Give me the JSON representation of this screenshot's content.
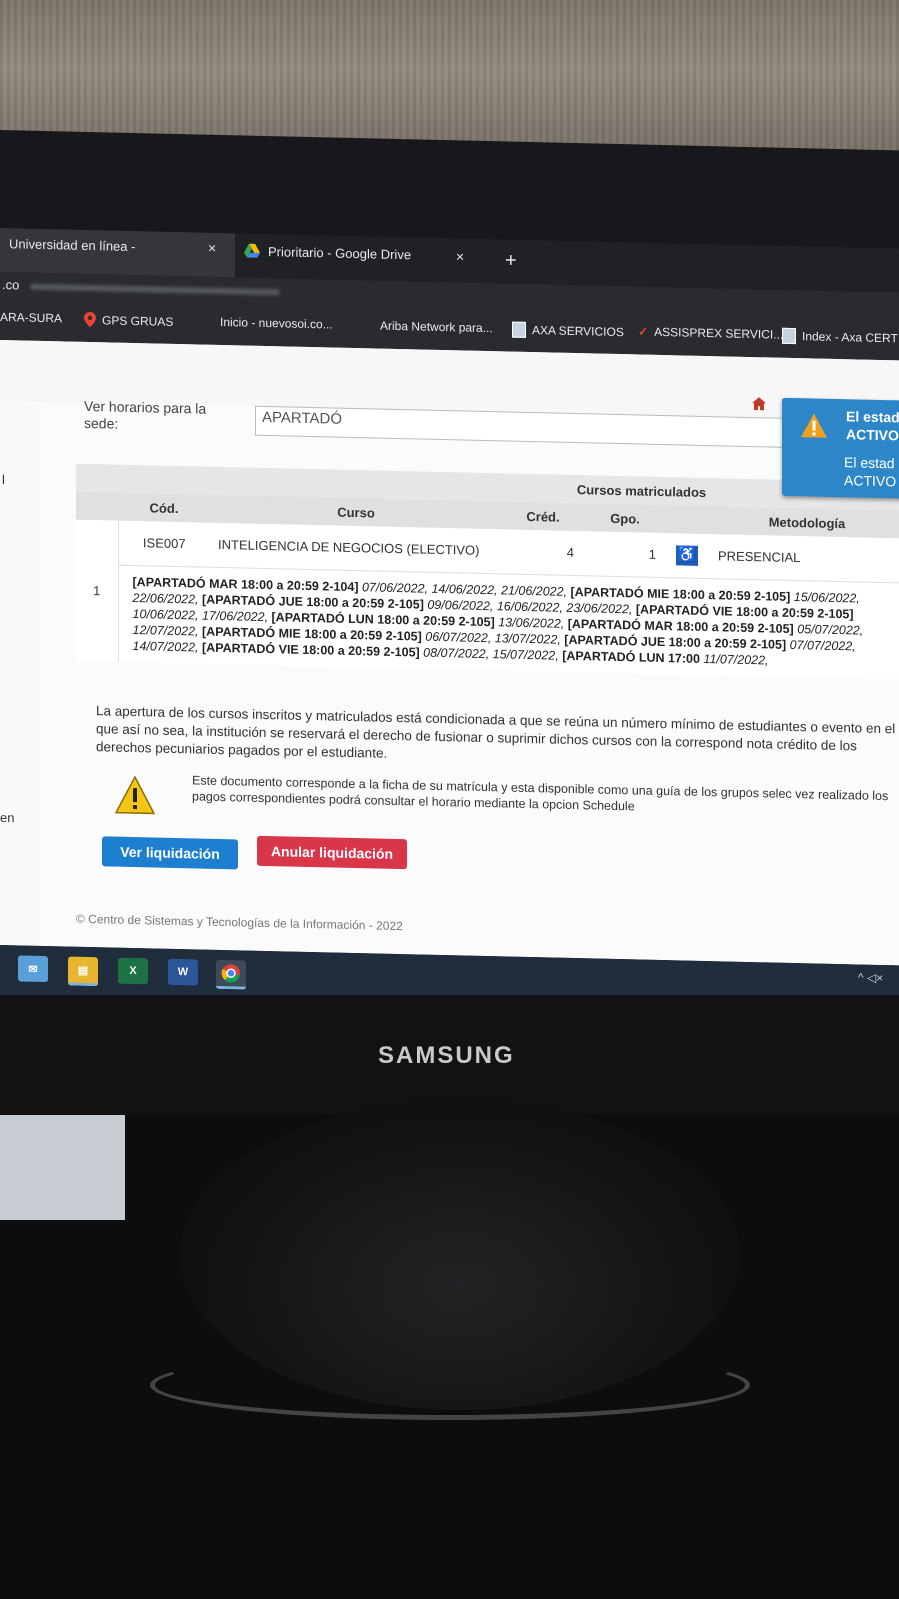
{
  "browser": {
    "tabs": [
      {
        "label": "Universidad en línea -",
        "close": "×"
      },
      {
        "label": "Prioritario - Google Drive",
        "close": "×"
      }
    ],
    "new_tab": "+",
    "url_prefix": ".co",
    "bookmarks": [
      {
        "label": "ARA-SURA"
      },
      {
        "label": "GPS GRUAS"
      },
      {
        "label": "Inicio - nuevosoi.co..."
      },
      {
        "label": "Ariba Network para..."
      },
      {
        "label": "AXA SERVICIOS"
      },
      {
        "label": "ASSISPREX SERVICI..."
      },
      {
        "label": "Index - Axa CERTI"
      }
    ]
  },
  "page": {
    "sede_label": "Ver horarios para la sede:",
    "sede_value": "APARTADÓ",
    "notice": {
      "line1": "El estad",
      "line2": "ACTIVO",
      "line3": "El estad",
      "line4": "ACTIVO"
    },
    "left_fragment_1": "l",
    "left_fragment_2": "en",
    "table": {
      "title": "Cursos matriculados",
      "headers": [
        "Cód.",
        "Curso",
        "Créd.",
        "Gpo.",
        "",
        "Metodología"
      ],
      "row_index": "1",
      "row": {
        "code": "ISE007",
        "course": "INTELIGENCIA DE NEGOCIOS (ELECTIVO)",
        "credits": "4",
        "group": "1",
        "method": "PRESENCIAL"
      },
      "schedule": [
        {
          "bold": "[APARTADÓ MAR 18:00 a 20:59 2-104]",
          "dates": " 07/06/2022, 14/06/2022, 21/06/2022, "
        },
        {
          "bold": "[APARTADÓ MIE 18:00 a 20:59 2-105]",
          "dates": " 15/06/2022, 22/06/2022, "
        },
        {
          "bold": "[APARTADÓ JUE 18:00 a 20:59 2-105]",
          "dates": " 09/06/2022, 16/06/2022, 23/06/2022, "
        },
        {
          "bold": "[APARTADÓ VIE 18:00 a 20:59 2-105]",
          "dates": " 10/06/2022, 17/06/2022, "
        },
        {
          "bold": "[APARTADÓ LUN 18:00 a 20:59 2-105]",
          "dates": " 13/06/2022, "
        },
        {
          "bold": "[APARTADÓ MAR 18:00 a 20:59 2-105]",
          "dates": " 05/07/2022, 12/07/2022, "
        },
        {
          "bold": "[APARTADÓ MIE 18:00 a 20:59 2-105]",
          "dates": " 06/07/2022, 13/07/2022, "
        },
        {
          "bold": "[APARTADÓ JUE 18:00 a 20:59 2-105]",
          "dates": " 07/07/2022, 14/07/2022, "
        },
        {
          "bold": "[APARTADÓ VIE 18:00 a 20:59 2-105]",
          "dates": " 08/07/2022, 15/07/2022, "
        },
        {
          "bold": "[APARTADÓ LUN 17:00",
          "dates": " 11/07/2022,"
        }
      ]
    },
    "disclaimer": "La apertura de los cursos inscritos y matriculados está condicionada a que se reúna un número mínimo de estudiantes o evento en el que así no sea, la institución se reservará el derecho de fusionar o suprimir dichos cursos con la correspond nota crédito de los derechos pecuniarios pagados por el estudiante.",
    "warning_text": "Este documento corresponde a la ficha de su matrícula y esta disponible como una guía de los grupos selec vez realizado los pagos correspondientes podrá consultar el horario mediante la opcion Schedule",
    "buttons": {
      "ver": "Ver liquidación",
      "anular": "Anular liquidación"
    },
    "footer": "© Centro de Sistemas y Tecnologías de la Información - 2022"
  },
  "taskbar": {
    "icons": [
      "outlook-icon",
      "file-explorer-icon",
      "excel-icon",
      "word-icon",
      "chrome-icon"
    ],
    "tray": "^ ◁×"
  },
  "monitor": {
    "brand": "SAMSUNG"
  },
  "colors": {
    "primary_button": "#1e7fd0",
    "danger_button": "#d9364a",
    "notice": "#2d86c8",
    "taskbar": "#1f2d3c"
  }
}
